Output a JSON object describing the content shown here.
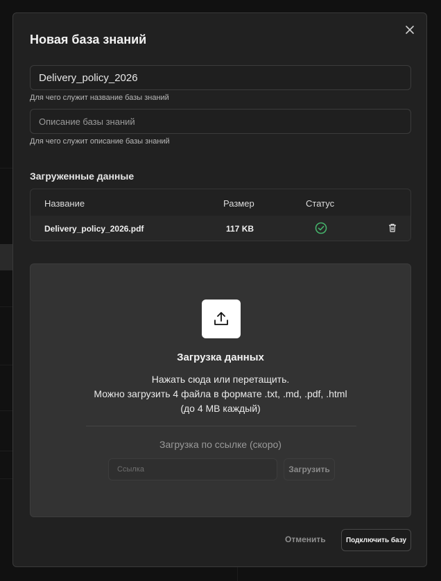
{
  "modal": {
    "title": "Новая база знаний",
    "name_value": "Delivery_policy_2026",
    "name_hint": "Для чего служит название базы знаний",
    "description_placeholder": "Описание базы знаний",
    "description_hint": "Для чего служит описание базы знаний"
  },
  "uploaded": {
    "section_title": "Загруженные данные",
    "columns": [
      "Название",
      "Размер",
      "Статус"
    ],
    "rows": [
      {
        "name": "Delivery_policy_2026.pdf",
        "size": "117 KB",
        "status": "ok"
      }
    ]
  },
  "dropzone": {
    "title": "Загрузка данных",
    "line1": "Нажать сюда или перетащить.",
    "line2": "Можно загрузить 4 файла в формате .txt, .md, .pdf, .html",
    "line3": "(до 4 MB каждый)",
    "url_header": "Загрузка по ссылке (скоро)",
    "url_placeholder": "Ссылка",
    "url_button": "Загрузить"
  },
  "footer": {
    "cancel_label": "Отменить",
    "connect_label": "Подключить базу"
  },
  "colors": {
    "status_ok": "#45b36b",
    "modal_bg": "#212121",
    "dropzone_bg": "#333333"
  },
  "icons": {
    "close": "close-icon",
    "upload": "upload-icon",
    "status": "check-circle-icon",
    "delete": "trash-icon"
  }
}
